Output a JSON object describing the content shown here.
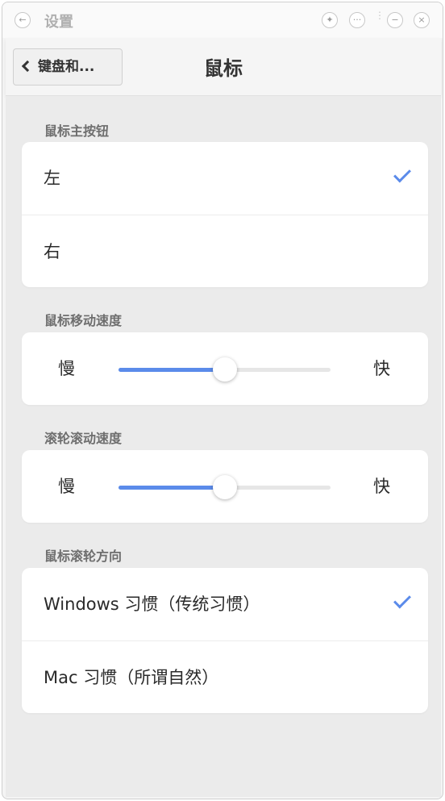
{
  "window": {
    "title": "设置"
  },
  "titlebar": {
    "back_icon": "←",
    "pin_icon": "✦",
    "more_icon": "···",
    "min_icon": "−",
    "close_icon": "×"
  },
  "nav": {
    "back_label": "键盘和...",
    "title": "鼠标"
  },
  "primary_button": {
    "label": "鼠标主按钮",
    "options": [
      {
        "label": "左",
        "selected": true
      },
      {
        "label": "右",
        "selected": false
      }
    ]
  },
  "pointer_speed": {
    "label": "鼠标移动速度",
    "min_label": "慢",
    "max_label": "快",
    "value": 0.5
  },
  "scroll_speed": {
    "label": "滚轮滚动速度",
    "min_label": "慢",
    "max_label": "快",
    "value": 0.5
  },
  "scroll_direction": {
    "label": "鼠标滚轮方向",
    "options": [
      {
        "label": "Windows 习惯（传统习惯）",
        "selected": true
      },
      {
        "label": "Mac 习惯（所谓自然）",
        "selected": false
      }
    ]
  },
  "accent_color": "#5b8bea"
}
